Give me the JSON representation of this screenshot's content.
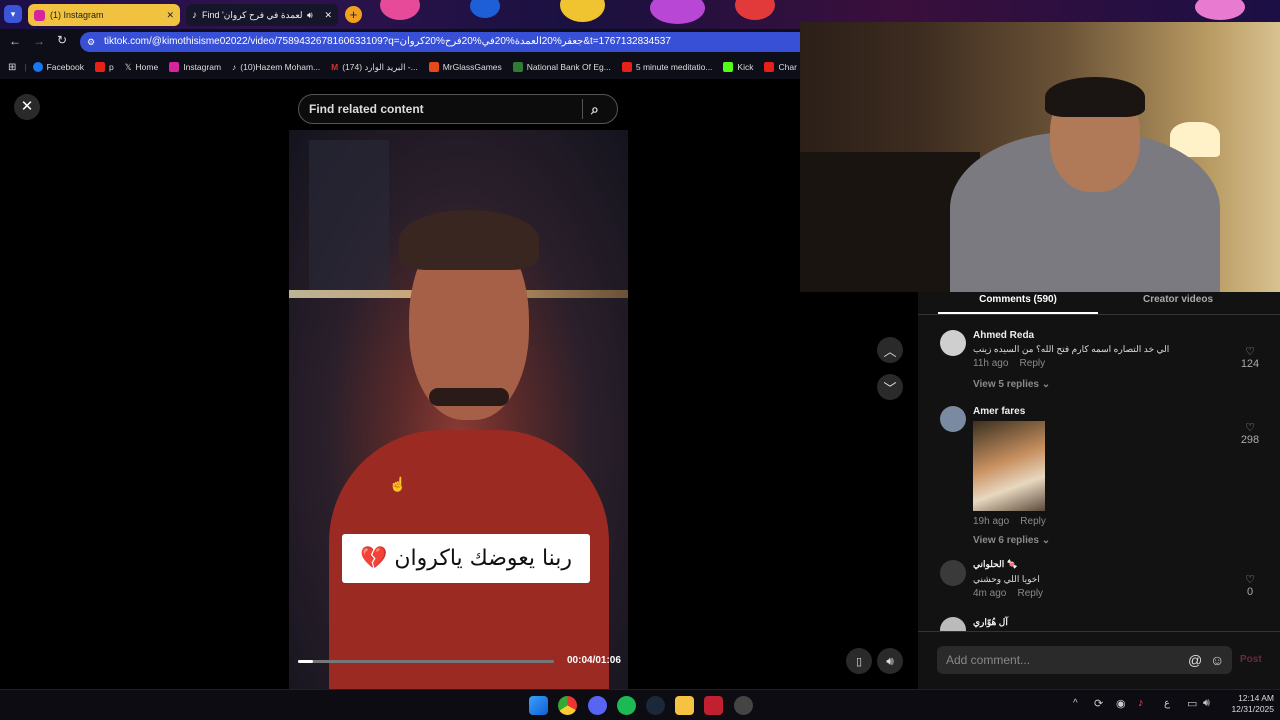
{
  "browser": {
    "tabs": [
      {
        "label": "(1) Instagram",
        "active": false
      },
      {
        "label": "Find 'العمدة في فرح كروان' on TikTok",
        "active": true
      }
    ],
    "url": "tiktok.com/@kimothisisme02022/video/7589432678160633109?q=جعفر%20العمدة%20في%20فرح%20كروان&t=1767132834537",
    "bookmarks": [
      {
        "label": "Facebook",
        "color": "#1877f2"
      },
      {
        "label": "p",
        "color": "#e62117"
      },
      {
        "label": "Home",
        "color": "#ffffff"
      },
      {
        "label": "Instagram",
        "color": "#d6249f"
      },
      {
        "label": "(10)Hazem Moham...",
        "color": "#ffffff"
      },
      {
        "label": "(174) البريد الوارد -...",
        "color": "#d93025"
      },
      {
        "label": "MrGlassGames",
        "color": "#e64a19"
      },
      {
        "label": "National Bank Of Eg...",
        "color": "#2e7d32"
      },
      {
        "label": "5 minute meditatio...",
        "color": "#e62117"
      },
      {
        "label": "Kick",
        "color": "#53fc18"
      },
      {
        "label": "Char",
        "color": "#e62117"
      }
    ]
  },
  "tiktok": {
    "search_placeholder": "Find related content",
    "caption": "ربنا يعوضك ياكروان 💔",
    "time": "00:04/01:06",
    "progress": 0.06,
    "tabs": {
      "comments": "Comments (590)",
      "creator": "Creator videos"
    },
    "comments": [
      {
        "name": "Ahmed Reda",
        "text": "الي خد التصاره اسمه كارم فتح الله؟ من السيده زينب",
        "time": "11h ago",
        "reply": "Reply",
        "likes": "124",
        "replies": "View 5 replies"
      },
      {
        "name": "Amer fares",
        "text": "",
        "time": "19h ago",
        "reply": "Reply",
        "likes": "298",
        "replies": "View 6 replies"
      },
      {
        "name": "الحلواني 🍬",
        "text": "اخويا اللي وحشني",
        "time": "4m ago",
        "reply": "Reply",
        "likes": "0"
      },
      {
        "name": "آل هُوّاري"
      }
    ],
    "add_comment_placeholder": "Add comment...",
    "post_label": "Post"
  },
  "taskbar": {
    "time": "12:14 AM",
    "date": "12/31/2025",
    "lang": "ع"
  }
}
